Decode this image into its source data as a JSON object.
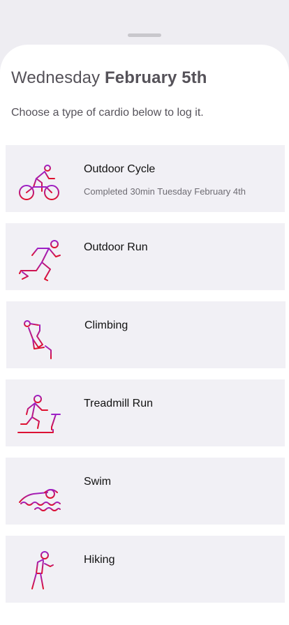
{
  "header": {
    "weekday": "Wednesday",
    "date": "February 5th",
    "subtitle": "Choose a type of cardio below to log it."
  },
  "activities": [
    {
      "name": "Outdoor Cycle",
      "note": "Completed 30min Tuesday February 4th",
      "icon": "bicycle-icon"
    },
    {
      "name": "Outdoor Run",
      "note": "",
      "icon": "running-icon"
    },
    {
      "name": "Climbing",
      "note": "",
      "icon": "climbing-icon"
    },
    {
      "name": "Treadmill Run",
      "note": "",
      "icon": "treadmill-icon"
    },
    {
      "name": "Swim",
      "note": "",
      "icon": "swimming-icon"
    },
    {
      "name": "Hiking",
      "note": "",
      "icon": "hiking-icon"
    }
  ],
  "colors": {
    "icon_gradient_start": "#9b20c8",
    "icon_gradient_end": "#e0102a",
    "card_background": "#f1f0f5"
  }
}
